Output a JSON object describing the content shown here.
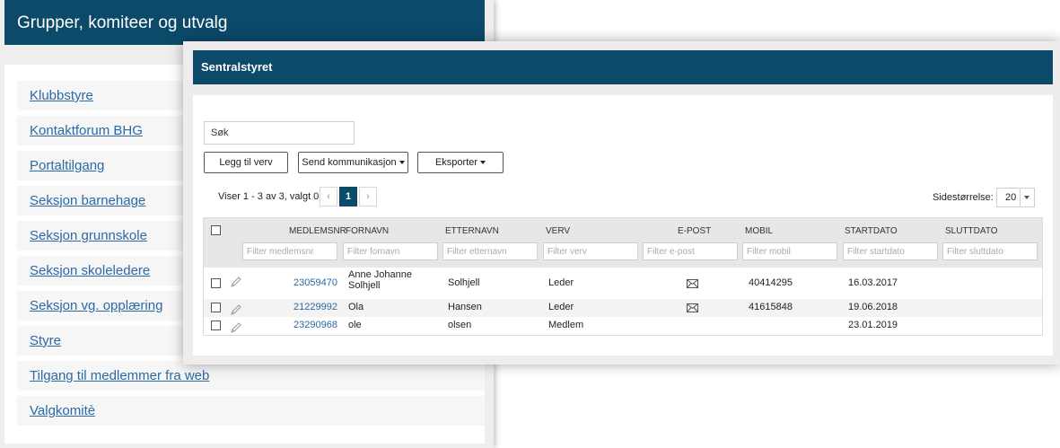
{
  "background": {
    "title": "Grupper, komiteer og utvalg",
    "items": [
      {
        "label": "Klubbstyre"
      },
      {
        "label": "Kontaktforum BHG"
      },
      {
        "label": "Portaltilgang"
      },
      {
        "label": "Seksjon barnehage"
      },
      {
        "label": "Seksjon grunnskole"
      },
      {
        "label": "Seksjon skoleledere"
      },
      {
        "label": "Seksjon vg. opplæring"
      },
      {
        "label": "Styre"
      },
      {
        "label": "Tilgang til medlemmer fra web"
      },
      {
        "label": "Valgkomitè"
      }
    ]
  },
  "modal": {
    "title": "Sentralstyret",
    "search_placeholder": "Søk",
    "buttons": {
      "add_role": "Legg til verv",
      "send_comm": "Send kommunikasjon",
      "export": "Eksporter"
    },
    "pager": {
      "summary": "Viser 1 - 3 av 3, valgt 0",
      "prev": "‹",
      "current": "1",
      "next": "›",
      "page_size_label": "Sidestørrelse:",
      "page_size": "20"
    },
    "columns": {
      "memberno": "MEDLEMSNR",
      "firstname": "FORNAVN",
      "lastname": "ETTERNAVN",
      "role": "VERV",
      "email": "E-POST",
      "mobile": "MOBIL",
      "start": "STARTDATO",
      "end": "SLUTTDATO"
    },
    "filters": {
      "memberno": "Filter medlemsnr",
      "firstname": "Filter fornavn",
      "lastname": "Filter etternavn",
      "role": "Filter verv",
      "email": "Filter e-post",
      "mobile": "Filter mobil",
      "start": "Filter startdato",
      "end": "Filter sluttdato"
    },
    "rows": [
      {
        "memberno": "23059470",
        "firstname_line1": "Anne Johanne",
        "firstname_line2": "Solhjell",
        "lastname": "Solhjell",
        "role": "Leder",
        "mobile": "40414295",
        "start": "16.03.2017",
        "end": ""
      },
      {
        "memberno": "21229992",
        "firstname": "Ola",
        "lastname": "Hansen",
        "role": "Leder",
        "mobile": "41615848",
        "start": "19.06.2018",
        "end": ""
      },
      {
        "memberno": "23290968",
        "firstname": "ole",
        "lastname": "olsen",
        "role": "Medlem",
        "mobile": "",
        "start": "23.01.2019",
        "end": ""
      }
    ]
  }
}
